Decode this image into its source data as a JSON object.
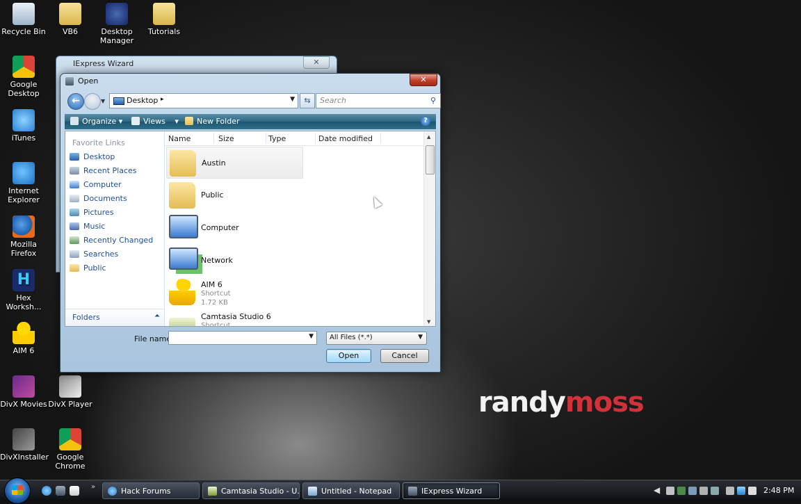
{
  "wallpaper": {
    "text_part1": "randy",
    "text_part2": "moss"
  },
  "desktop_icons": [
    {
      "label": "Recycle Bin",
      "icon": "recycle-bin-icon"
    },
    {
      "label": "VB6",
      "icon": "folder-icon"
    },
    {
      "label": "Desktop Manager",
      "icon": "desktop-manager-icon"
    },
    {
      "label": "Tutorials",
      "icon": "folder-icon"
    },
    {
      "label": "Google Desktop",
      "icon": "google-desktop-icon"
    },
    {
      "label": "iTunes",
      "icon": "itunes-icon"
    },
    {
      "label": "Internet Explorer",
      "icon": "internet-explorer-icon"
    },
    {
      "label": "Mozilla Firefox",
      "icon": "firefox-icon"
    },
    {
      "label": "Hex Worksh...",
      "icon": "hex-workshop-icon"
    },
    {
      "label": "AIM 6",
      "icon": "aim-icon"
    },
    {
      "label": "DivX Movies",
      "icon": "divx-movies-icon"
    },
    {
      "label": "DivX Player",
      "icon": "divx-player-icon"
    },
    {
      "label": "DivXInstaller",
      "icon": "divx-installer-icon"
    },
    {
      "label": "Google Chrome",
      "icon": "chrome-icon"
    }
  ],
  "background_window": {
    "title": "IExpress Wizard",
    "close_label": "✕"
  },
  "dialog": {
    "title": "Open",
    "close_label": "✕",
    "address": {
      "location": "Desktop",
      "separator": "▸"
    },
    "search": {
      "placeholder": "Search"
    },
    "toolbar": {
      "organize": "Organize",
      "views": "Views",
      "new_folder": "New Folder",
      "help": "?"
    },
    "favorite_links": {
      "heading": "Favorite Links",
      "items": [
        "Desktop",
        "Recent Places",
        "Computer",
        "Documents",
        "Pictures",
        "Music",
        "Recently Changed",
        "Searches",
        "Public"
      ]
    },
    "folders_label": "Folders",
    "columns": [
      "Name",
      "Size",
      "Type",
      "Date modified"
    ],
    "files": [
      {
        "name": "Austin",
        "icon": "user-folder-icon"
      },
      {
        "name": "Public",
        "icon": "folder-icon"
      },
      {
        "name": "Computer",
        "icon": "computer-icon"
      },
      {
        "name": "Network",
        "icon": "network-icon"
      },
      {
        "name": "AIM 6",
        "type": "Shortcut",
        "size": "1.72 KB",
        "icon": "aim-shortcut-icon"
      },
      {
        "name": "Camtasia Studio 6",
        "type": "Shortcut",
        "icon": "camtasia-shortcut-icon"
      }
    ],
    "file_name_label": "File name:",
    "file_name_value": "",
    "filter_value": "All Files (*.*)",
    "open_button": "Open",
    "cancel_button": "Cancel"
  },
  "taskbar": {
    "tasks": [
      {
        "label": "Hack Forums",
        "icon": "browser-icon"
      },
      {
        "label": "Camtasia Studio - U...",
        "icon": "camtasia-icon"
      },
      {
        "label": "Untitled - Notepad",
        "icon": "notepad-icon"
      },
      {
        "label": "IExpress Wizard",
        "icon": "iexpress-icon"
      }
    ],
    "tray_chevron": "◀",
    "clock": "2:48 PM"
  }
}
